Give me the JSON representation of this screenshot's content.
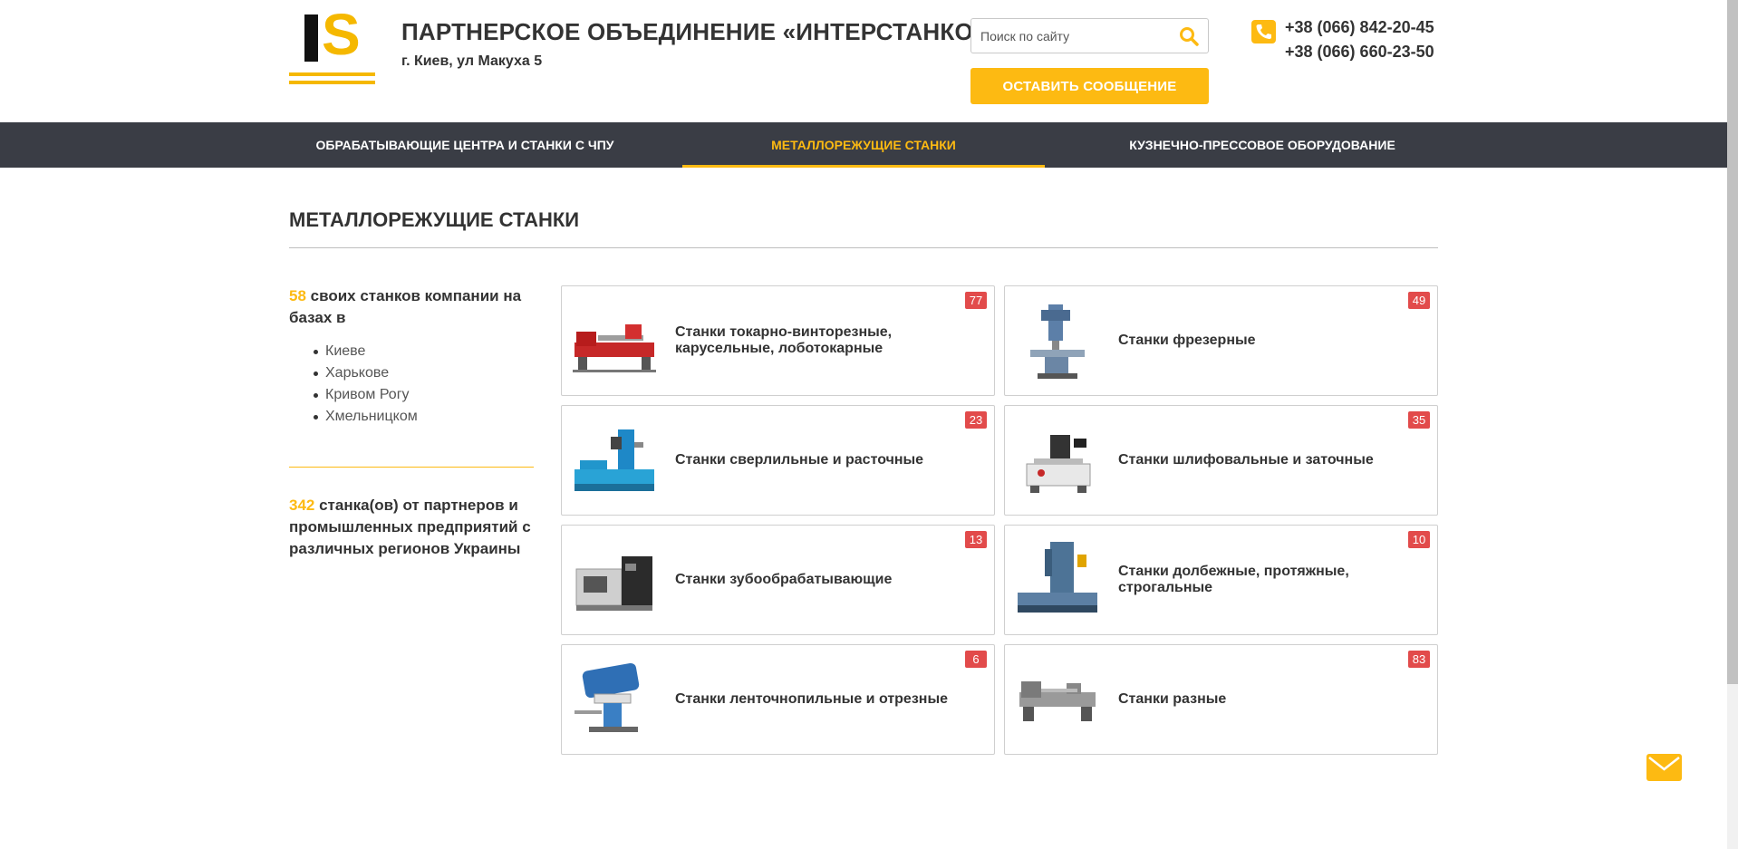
{
  "header": {
    "logo_text": "IS",
    "title": "ПАРТНЕРСКОЕ ОБЪЕДИНЕНИЕ «ИНТЕРСТАНКО»",
    "address": "г. Киев, ул Макуха 5",
    "search": {
      "placeholder": "Поиск по сайту"
    },
    "message_button": "ОСТАВИТЬ СООБЩЕНИЕ",
    "phones": [
      "+38 (066) 842-20-45",
      "+38 (066) 660-23-50"
    ]
  },
  "nav": {
    "items": [
      {
        "label": "ОБРАБАТЫВАЮЩИЕ ЦЕНТРА И СТАНКИ С ЧПУ",
        "active": false
      },
      {
        "label": "МЕТАЛЛОРЕЖУЩИЕ СТАНКИ",
        "active": true
      },
      {
        "label": "КУЗНЕЧНО-ПРЕССОВОЕ ОБОРУДОВАНИЕ",
        "active": false
      }
    ]
  },
  "page": {
    "title": "МЕТАЛЛОРЕЖУЩИЕ СТАНКИ"
  },
  "sidebar": {
    "own_count": "58",
    "own_text": " своих станков компании на базах в",
    "cities": [
      "Киеве",
      "Харькове",
      "Кривом Рогу",
      "Хмельницком"
    ],
    "partners_count": "342",
    "partners_text": " станка(ов) от партнеров и промышленных предприятий с различных регионов Украины"
  },
  "categories": [
    {
      "title": "Станки токарно-винторезные, карусельные, лоботокарные",
      "count": "77",
      "icon": "lathe-machine-image"
    },
    {
      "title": "Станки фрезерные",
      "count": "49",
      "icon": "milling-machine-image"
    },
    {
      "title": "Станки сверлильные и расточные",
      "count": "23",
      "icon": "drilling-machine-image"
    },
    {
      "title": "Станки шлифовальные и заточные",
      "count": "35",
      "icon": "grinding-machine-image"
    },
    {
      "title": "Станки зубообрабатывающие",
      "count": "13",
      "icon": "gear-cutting-machine-image"
    },
    {
      "title": "Станки долбежные, протяжные, строгальные",
      "count": "10",
      "icon": "slotting-machine-image"
    },
    {
      "title": "Станки ленточнопильные и отрезные",
      "count": "6",
      "icon": "band-saw-machine-image"
    },
    {
      "title": "Станки разные",
      "count": "83",
      "icon": "misc-machine-image"
    }
  ],
  "colors": {
    "accent": "#fdba12",
    "nav_bg": "#3a3d45",
    "badge": "#e24b4b",
    "text": "#333333"
  }
}
